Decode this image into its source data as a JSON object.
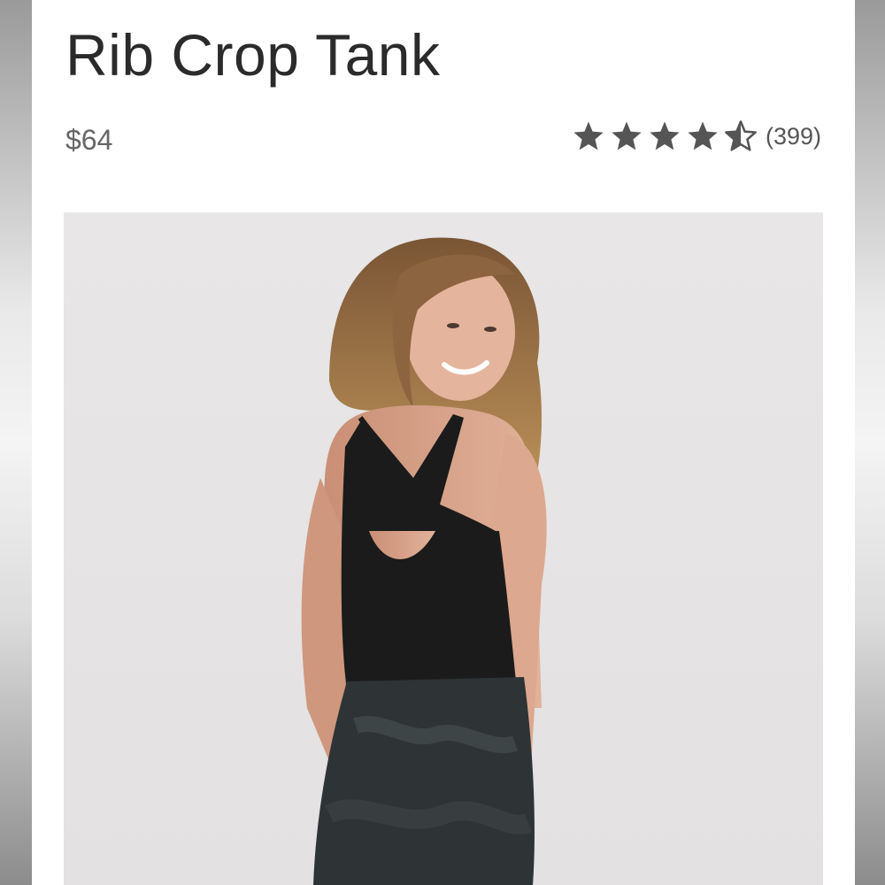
{
  "product": {
    "title": "Rib Crop Tank",
    "price": "$64",
    "rating": {
      "value": 4.5,
      "max": 5,
      "count_label": "(399)"
    }
  },
  "colors": {
    "title": "#2b2b2b",
    "price": "#666666",
    "star": "#555555",
    "photo_background": "#e7e5e5"
  },
  "image": {
    "description_icon": "product-photo"
  }
}
